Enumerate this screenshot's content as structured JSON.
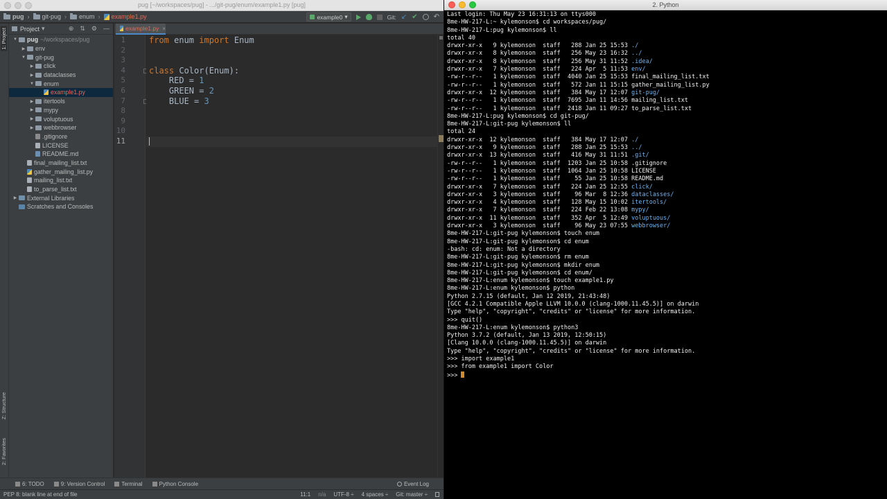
{
  "ide": {
    "window_title": "pug [~/workspaces/pug] - .../git-pug/enum/example1.py [pug]",
    "breadcrumbs": [
      "pug",
      "git-pug",
      "enum",
      "example1.py"
    ],
    "run_config": "example0",
    "git_label": "Git:",
    "left_tabs": {
      "project": "1: Project",
      "structure": "Z: Structure",
      "favorites": "2: Favorites"
    },
    "project_pane": {
      "title": "Project",
      "tree": [
        {
          "label": "pug",
          "path": "~/workspaces/pug",
          "indent": 0,
          "arrow": "down",
          "icon": "folder",
          "bold": true
        },
        {
          "label": "env",
          "indent": 1,
          "arrow": "right",
          "icon": "folder"
        },
        {
          "label": "git-pug",
          "indent": 1,
          "arrow": "down",
          "icon": "folder"
        },
        {
          "label": "click",
          "indent": 2,
          "arrow": "right",
          "icon": "folder"
        },
        {
          "label": "dataclasses",
          "indent": 2,
          "arrow": "right",
          "icon": "folder"
        },
        {
          "label": "enum",
          "indent": 2,
          "arrow": "down",
          "icon": "folder"
        },
        {
          "label": "example1.py",
          "indent": 3,
          "arrow": "",
          "icon": "file-py",
          "selected": true,
          "red": true
        },
        {
          "label": "itertools",
          "indent": 2,
          "arrow": "right",
          "icon": "folder"
        },
        {
          "label": "mypy",
          "indent": 2,
          "arrow": "right",
          "icon": "folder"
        },
        {
          "label": "voluptuous",
          "indent": 2,
          "arrow": "right",
          "icon": "folder"
        },
        {
          "label": "webbrowser",
          "indent": 2,
          "arrow": "right",
          "icon": "folder"
        },
        {
          "label": ".gitignore",
          "indent": 2,
          "arrow": "",
          "icon": "file-git"
        },
        {
          "label": "LICENSE",
          "indent": 2,
          "arrow": "",
          "icon": "file-txt"
        },
        {
          "label": "README.md",
          "indent": 2,
          "arrow": "",
          "icon": "file-md"
        },
        {
          "label": "final_mailing_list.txt",
          "indent": 1,
          "arrow": "",
          "icon": "file-txt"
        },
        {
          "label": "gather_mailing_list.py",
          "indent": 1,
          "arrow": "",
          "icon": "file-py"
        },
        {
          "label": "mailing_list.txt",
          "indent": 1,
          "arrow": "",
          "icon": "file-txt"
        },
        {
          "label": "to_parse_list.txt",
          "indent": 1,
          "arrow": "",
          "icon": "file-txt"
        },
        {
          "label": "External Libraries",
          "indent": 0,
          "arrow": "right",
          "icon": "lib"
        },
        {
          "label": "Scratches and Consoles",
          "indent": 0,
          "arrow": "",
          "icon": "scratch"
        }
      ]
    },
    "editor": {
      "tab_label": "example1.py",
      "line_numbers": [
        "1",
        "2",
        "3",
        "4",
        "5",
        "6",
        "7",
        "8",
        "9",
        "10",
        "11"
      ],
      "current_line": 11,
      "lines": [
        [
          {
            "t": "from",
            "c": "kw"
          },
          {
            "t": " enum "
          },
          {
            "t": "import",
            "c": "kw"
          },
          {
            "t": " Enum"
          }
        ],
        [],
        [],
        [
          {
            "t": "class",
            "c": "kw"
          },
          {
            "t": " Color(Enum):"
          }
        ],
        [
          {
            "t": "    RED = "
          },
          {
            "t": "1",
            "c": "num"
          }
        ],
        [
          {
            "t": "    GREEN = "
          },
          {
            "t": "2",
            "c": "num"
          }
        ],
        [
          {
            "t": "    BLUE = "
          },
          {
            "t": "3",
            "c": "num"
          }
        ],
        [],
        [],
        [],
        []
      ]
    },
    "tool_windows": [
      "6: TODO",
      "9: Version Control",
      "Terminal",
      "Python Console"
    ],
    "event_log": "Event Log",
    "status": {
      "message": "PEP 8: blank line at end of file",
      "position": "11:1",
      "line_sep": "n/a",
      "encoding": "UTF-8 ÷",
      "indent": "4 spaces ÷",
      "branch": "Git: master ÷"
    }
  },
  "terminal": {
    "title": "2. Python",
    "lines": [
      [
        {
          "t": "Last login: Thu May 23 16:31:13 on ttys000"
        }
      ],
      [
        {
          "t": "8me-HW-217-L:~ kylemonson$ cd workspaces/pug/"
        }
      ],
      [
        {
          "t": "8me-HW-217-L:pug kylemonson$ ll"
        }
      ],
      [
        {
          "t": "total 40"
        }
      ],
      [
        {
          "t": "drwxr-xr-x   9 kylemonson  staff   288 Jan 25 15:53 "
        },
        {
          "t": "./",
          "c": "dir"
        }
      ],
      [
        {
          "t": "drwxr-xr-x   8 kylemonson  staff   256 May 23 16:32 "
        },
        {
          "t": "../",
          "c": "dir"
        }
      ],
      [
        {
          "t": "drwxr-xr-x   8 kylemonson  staff   256 May 31 11:52 "
        },
        {
          "t": ".idea/",
          "c": "dir"
        }
      ],
      [
        {
          "t": "drwxr-xr-x   7 kylemonson  staff   224 Apr  5 11:53 "
        },
        {
          "t": "env/",
          "c": "dir"
        }
      ],
      [
        {
          "t": "-rw-r--r--   1 kylemonson  staff  4040 Jan 25 15:53 final_mailing_list.txt"
        }
      ],
      [
        {
          "t": "-rw-r--r--   1 kylemonson  staff   572 Jan 11 15:15 gather_mailing_list.py"
        }
      ],
      [
        {
          "t": "drwxr-xr-x  12 kylemonson  staff   384 May 17 12:07 "
        },
        {
          "t": "git-pug/",
          "c": "dir"
        }
      ],
      [
        {
          "t": "-rw-r--r--   1 kylemonson  staff  7695 Jan 11 14:56 mailing_list.txt"
        }
      ],
      [
        {
          "t": "-rw-r--r--   1 kylemonson  staff  2418 Jan 11 09:27 to_parse_list.txt"
        }
      ],
      [
        {
          "t": "8me-HW-217-L:pug kylemonson$ cd git-pug/"
        }
      ],
      [
        {
          "t": "8me-HW-217-L:git-pug kylemonson$ ll"
        }
      ],
      [
        {
          "t": "total 24"
        }
      ],
      [
        {
          "t": "drwxr-xr-x  12 kylemonson  staff   384 May 17 12:07 "
        },
        {
          "t": "./",
          "c": "dir"
        }
      ],
      [
        {
          "t": "drwxr-xr-x   9 kylemonson  staff   288 Jan 25 15:53 "
        },
        {
          "t": "../",
          "c": "dir"
        }
      ],
      [
        {
          "t": "drwxr-xr-x  13 kylemonson  staff   416 May 31 11:51 "
        },
        {
          "t": ".git/",
          "c": "dir"
        }
      ],
      [
        {
          "t": "-rw-r--r--   1 kylemonson  staff  1203 Jan 25 10:58 .gitignore"
        }
      ],
      [
        {
          "t": "-rw-r--r--   1 kylemonson  staff  1064 Jan 25 10:58 LICENSE"
        }
      ],
      [
        {
          "t": "-rw-r--r--   1 kylemonson  staff    55 Jan 25 10:58 README.md"
        }
      ],
      [
        {
          "t": "drwxr-xr-x   7 kylemonson  staff   224 Jan 25 12:55 "
        },
        {
          "t": "click/",
          "c": "dir"
        }
      ],
      [
        {
          "t": "drwxr-xr-x   3 kylemonson  staff    96 Mar  8 12:36 "
        },
        {
          "t": "dataclasses/",
          "c": "dir"
        }
      ],
      [
        {
          "t": "drwxr-xr-x   4 kylemonson  staff   128 May 15 10:02 "
        },
        {
          "t": "itertools/",
          "c": "dir"
        }
      ],
      [
        {
          "t": "drwxr-xr-x   7 kylemonson  staff   224 Feb 22 13:08 "
        },
        {
          "t": "mypy/",
          "c": "dir"
        }
      ],
      [
        {
          "t": "drwxr-xr-x  11 kylemonson  staff   352 Apr  5 12:49 "
        },
        {
          "t": "voluptuous/",
          "c": "dir"
        }
      ],
      [
        {
          "t": "drwxr-xr-x   3 kylemonson  staff    96 May 23 07:55 "
        },
        {
          "t": "webbrowser/",
          "c": "dir"
        }
      ],
      [
        {
          "t": "8me-HW-217-L:git-pug kylemonson$ touch enum"
        }
      ],
      [
        {
          "t": "8me-HW-217-L:git-pug kylemonson$ cd enum"
        }
      ],
      [
        {
          "t": "-bash: cd: enum: Not a directory"
        }
      ],
      [
        {
          "t": "8me-HW-217-L:git-pug kylemonson$ rm enum"
        }
      ],
      [
        {
          "t": "8me-HW-217-L:git-pug kylemonson$ mkdir enum"
        }
      ],
      [
        {
          "t": "8me-HW-217-L:git-pug kylemonson$ cd enum/"
        }
      ],
      [
        {
          "t": "8me-HW-217-L:enum kylemonson$ touch example1.py"
        }
      ],
      [
        {
          "t": "8me-HW-217-L:enum kylemonson$ python"
        }
      ],
      [
        {
          "t": "Python 2.7.15 (default, Jan 12 2019, 21:43:48)"
        }
      ],
      [
        {
          "t": "[GCC 4.2.1 Compatible Apple LLVM 10.0.0 (clang-1000.11.45.5)] on darwin"
        }
      ],
      [
        {
          "t": "Type \"help\", \"copyright\", \"credits\" or \"license\" for more information."
        }
      ],
      [
        {
          "t": ">>> quit()"
        }
      ],
      [
        {
          "t": "8me-HW-217-L:enum kylemonson$ python3"
        }
      ],
      [
        {
          "t": "Python 3.7.2 (default, Jan 13 2019, 12:50:15)"
        }
      ],
      [
        {
          "t": "[Clang 10.0.0 (clang-1000.11.45.5)] on darwin"
        }
      ],
      [
        {
          "t": "Type \"help\", \"copyright\", \"credits\" or \"license\" for more information."
        }
      ],
      [
        {
          "t": ">>> import example1"
        }
      ],
      [
        {
          "t": ">>> from example1 import Color"
        }
      ],
      [
        {
          "t": ">>> "
        }
      ]
    ]
  }
}
